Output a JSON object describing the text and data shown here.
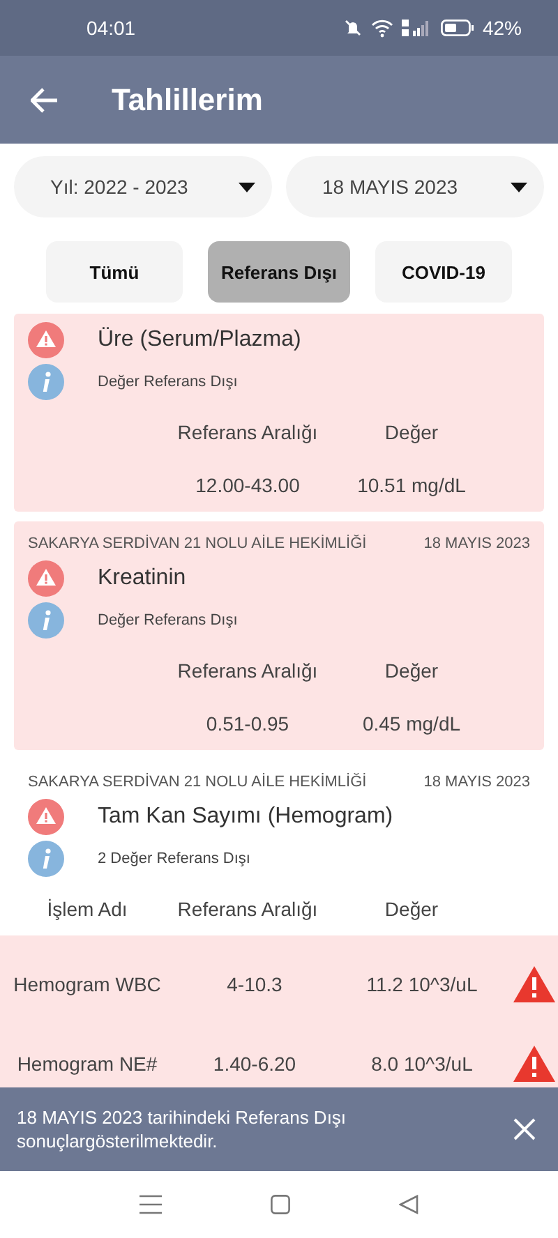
{
  "status_bar": {
    "time": "04:01",
    "battery": "42%"
  },
  "header": {
    "title": "Tahlillerim"
  },
  "filters": [
    {
      "label": "Yıl: 2022 - 2023"
    },
    {
      "label": "18 MAYIS 2023"
    }
  ],
  "tabs": [
    {
      "label": "Tümü",
      "selected": false
    },
    {
      "label": "Referans Dışı",
      "selected": true
    },
    {
      "label": "COVID-19",
      "selected": false
    }
  ],
  "results": [
    {
      "kind": "single",
      "name": "Üre (Serum/Plazma)",
      "note": "Değer Referans Dışı",
      "columns": [
        "Referans Aralığı",
        "Değer"
      ],
      "range": "12.00-43.00",
      "value": "10.51 mg/dL"
    },
    {
      "kind": "single",
      "facility": "SAKARYA SERDİVAN 21 NOLU AİLE HEKİMLİĞİ",
      "date": "18 MAYIS 2023",
      "name": "Kreatinin",
      "note": "Değer Referans Dışı",
      "columns": [
        "Referans Aralığı",
        "Değer"
      ],
      "range": "0.51-0.95",
      "value": "0.45 mg/dL"
    },
    {
      "kind": "panel",
      "facility": "SAKARYA SERDİVAN 21 NOLU AİLE HEKİMLİĞİ",
      "date": "18 MAYIS 2023",
      "name": "Tam Kan Sayımı (Hemogram)",
      "note": "2 Değer Referans Dışı",
      "columns": [
        "İşlem Adı",
        "Referans Aralığı",
        "Değer"
      ],
      "rows": [
        {
          "name": "Hemogram WBC",
          "range": "4-10.3",
          "value": "11.2 10^3/uL",
          "out_of_range": true
        },
        {
          "name": "Hemogram NE#",
          "range": "1.40-6.20",
          "value": "8.0 10^3/uL",
          "out_of_range": true
        }
      ]
    }
  ],
  "snackbar": {
    "text": "18 MAYIS 2023 tarihindeki Referans Dışı sonuçlargösterilmektedir."
  }
}
